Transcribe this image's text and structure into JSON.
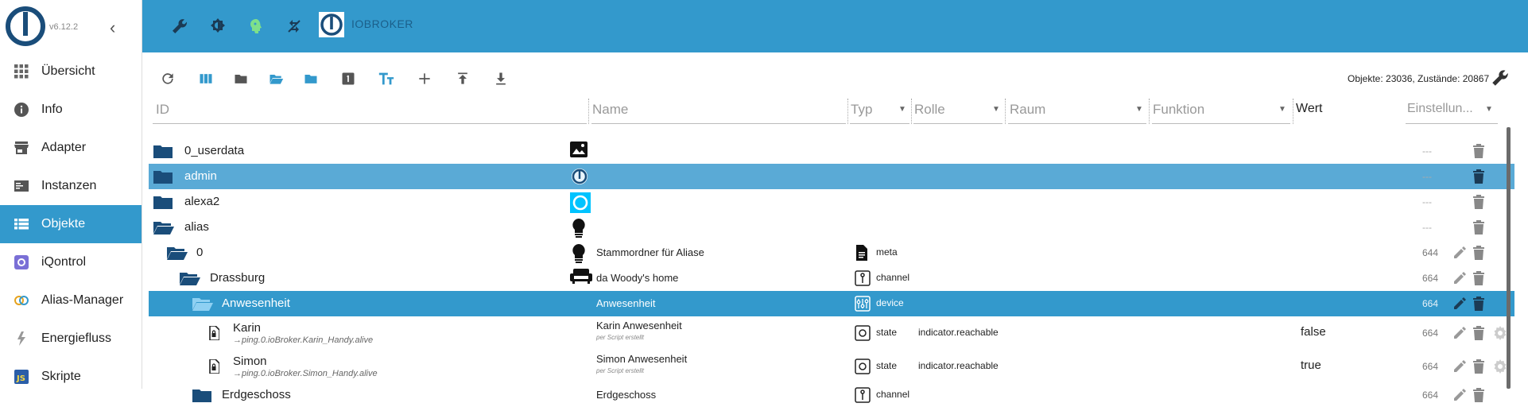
{
  "app": {
    "version": "v6.12.2",
    "brand": "IOBROKER"
  },
  "nav": [
    {
      "label": "Übersicht",
      "icon": "grid-icon"
    },
    {
      "label": "Info",
      "icon": "info-icon"
    },
    {
      "label": "Adapter",
      "icon": "store-icon"
    },
    {
      "label": "Instanzen",
      "icon": "instances-icon"
    },
    {
      "label": "Objekte",
      "icon": "list-icon",
      "active": true
    },
    {
      "label": "iQontrol",
      "icon": "iqontrol-icon"
    },
    {
      "label": "Alias-Manager",
      "icon": "alias-manager-icon"
    },
    {
      "label": "Energiefluss",
      "icon": "energy-flow-icon"
    },
    {
      "label": "Skripte",
      "icon": "js-icon"
    }
  ],
  "stats": "Objekte: 23036, Zustände: 20867",
  "columns": {
    "id": "ID",
    "name": "Name",
    "typ": "Typ",
    "rolle": "Rolle",
    "raum": "Raum",
    "funktion": "Funktion",
    "wert": "Wert",
    "einstellungen": "Einstellun..."
  },
  "rows": [
    {
      "id": "0_userdata",
      "level": 0,
      "kind": "folder",
      "name": "",
      "sub": "",
      "typ": "",
      "role": "",
      "wert": "",
      "acl": "---"
    },
    {
      "id": "admin",
      "level": 0,
      "kind": "folder",
      "name": "",
      "sub": "",
      "typ": "",
      "role": "",
      "wert": "",
      "acl": "---"
    },
    {
      "id": "alexa2",
      "level": 0,
      "kind": "folder",
      "name": "",
      "sub": "",
      "typ": "",
      "role": "",
      "wert": "",
      "acl": "---"
    },
    {
      "id": "alias",
      "level": 0,
      "kind": "folder-open",
      "name": "",
      "sub": "",
      "typ": "",
      "role": "",
      "wert": "",
      "acl": "---"
    },
    {
      "id": "0",
      "level": 1,
      "kind": "folder-open",
      "name": "Stammordner für Aliase",
      "sub": "",
      "typ": "meta",
      "role": "",
      "wert": "",
      "acl": "644"
    },
    {
      "id": "Drassburg",
      "level": 2,
      "kind": "folder-open",
      "name": "da Woody's home",
      "sub": "",
      "typ": "channel",
      "role": "",
      "wert": "",
      "acl": "664"
    },
    {
      "id": "Anwesenheit",
      "level": 3,
      "kind": "folder-open",
      "name": "Anwesenheit",
      "sub": "",
      "typ": "device",
      "role": "",
      "wert": "",
      "acl": "664"
    },
    {
      "id": "Karin",
      "level": 4,
      "kind": "state",
      "alias": "→ping.0.ioBroker.Karin_Handy.alive",
      "name": "Karin Anwesenheit",
      "sub": "per Script erstellt",
      "typ": "state",
      "role": "indicator.reachable",
      "wert": "false",
      "acl": "664"
    },
    {
      "id": "Simon",
      "level": 4,
      "kind": "state",
      "alias": "→ping.0.ioBroker.Simon_Handy.alive",
      "name": "Simon Anwesenheit",
      "sub": "per Script erstellt",
      "typ": "state",
      "role": "indicator.reachable",
      "wert": "true",
      "acl": "664"
    },
    {
      "id": "Erdgeschoss",
      "level": 3,
      "kind": "folder",
      "name": "Erdgeschoss",
      "sub": "",
      "typ": "channel",
      "role": "",
      "wert": "",
      "acl": "664"
    }
  ],
  "colors": {
    "accent": "#3399cc",
    "folder": "#1a4d7a",
    "selected": "#3399cc",
    "selected_light": "#5aaad6"
  }
}
